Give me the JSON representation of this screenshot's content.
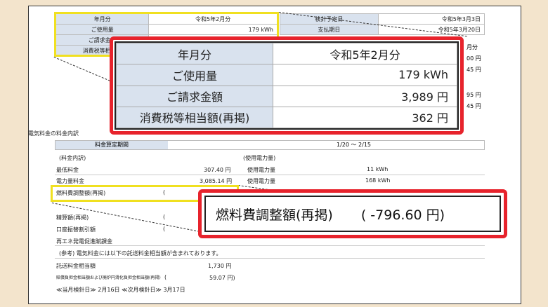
{
  "top_table": {
    "rows": [
      {
        "label": "年月分",
        "value": "令和5年2月分"
      },
      {
        "label": "ご使用量",
        "value": "179 kWh"
      },
      {
        "label": "ご請求金額",
        "value": ""
      },
      {
        "label": "消費税等相当額",
        "value": ""
      }
    ]
  },
  "right_table": {
    "rows": [
      {
        "label": "検針予定日",
        "value": "令和5年3月3日"
      },
      {
        "label": "支払期日",
        "value": "令和5年3月20日"
      }
    ],
    "frag1": "月分",
    "frag2": "00 円",
    "frag3": "45 円",
    "frag4": "95 円",
    "frag5": "45 円"
  },
  "detail": {
    "section_title": "電気料金の料金内訳",
    "period_label": "料金算定期間",
    "period_value": "1/20 〜 2/15",
    "breakdown_label": "(料金内訳)",
    "usage_label": "(使用電力量)",
    "rows": [
      {
        "label": "最低料金",
        "amount": "307.40 円",
        "usage_label": "使用電力量",
        "usage_value": "11 kWh"
      },
      {
        "label": "電力量料金",
        "amount": "3,085.14 円",
        "usage_label": "使用電力量",
        "usage_value": "168 kWh"
      }
    ],
    "fuel_label": "燃料費調整額(再掲)",
    "fuel_paren": "(",
    "seisan_label": "精算額(再掲)",
    "seisan_paren": "(",
    "koza_label": "口座振替割引額",
    "koza_paren": "(",
    "reene_label": "再エネ発電促進賦課金",
    "note": "(参考) 電気料金には以下の託送料金相当額が含まれております。",
    "takuso_label": "託送料金相当額",
    "takuso_value": "1,730 円",
    "hairo_label": "賠償負担金相当額および廃炉円滑化負担金相当額(再掲)",
    "hairo_value": "59.07 円)",
    "hairo_paren": "(",
    "meter_line": "≪当月検針日≫ 2月16日 ≪次月検針日≫ 3月17日"
  },
  "zoom_top": {
    "rows": [
      {
        "label": "年月分",
        "value": "令和5年2月分"
      },
      {
        "label": "ご使用量",
        "value": "179 kWh"
      },
      {
        "label": "ご請求金額",
        "value": "3,989 円"
      },
      {
        "label": "消費税等相当額(再掲)",
        "value": "362 円"
      }
    ]
  },
  "zoom_fuel": {
    "label": "燃料費調整額(再掲)",
    "value": "( -796.60 円)"
  },
  "colors": {
    "highlight_red": "#e7232c",
    "highlight_yellow": "#f0e020",
    "header_blue": "#d9e2ee",
    "background": "#f3e4cc"
  }
}
